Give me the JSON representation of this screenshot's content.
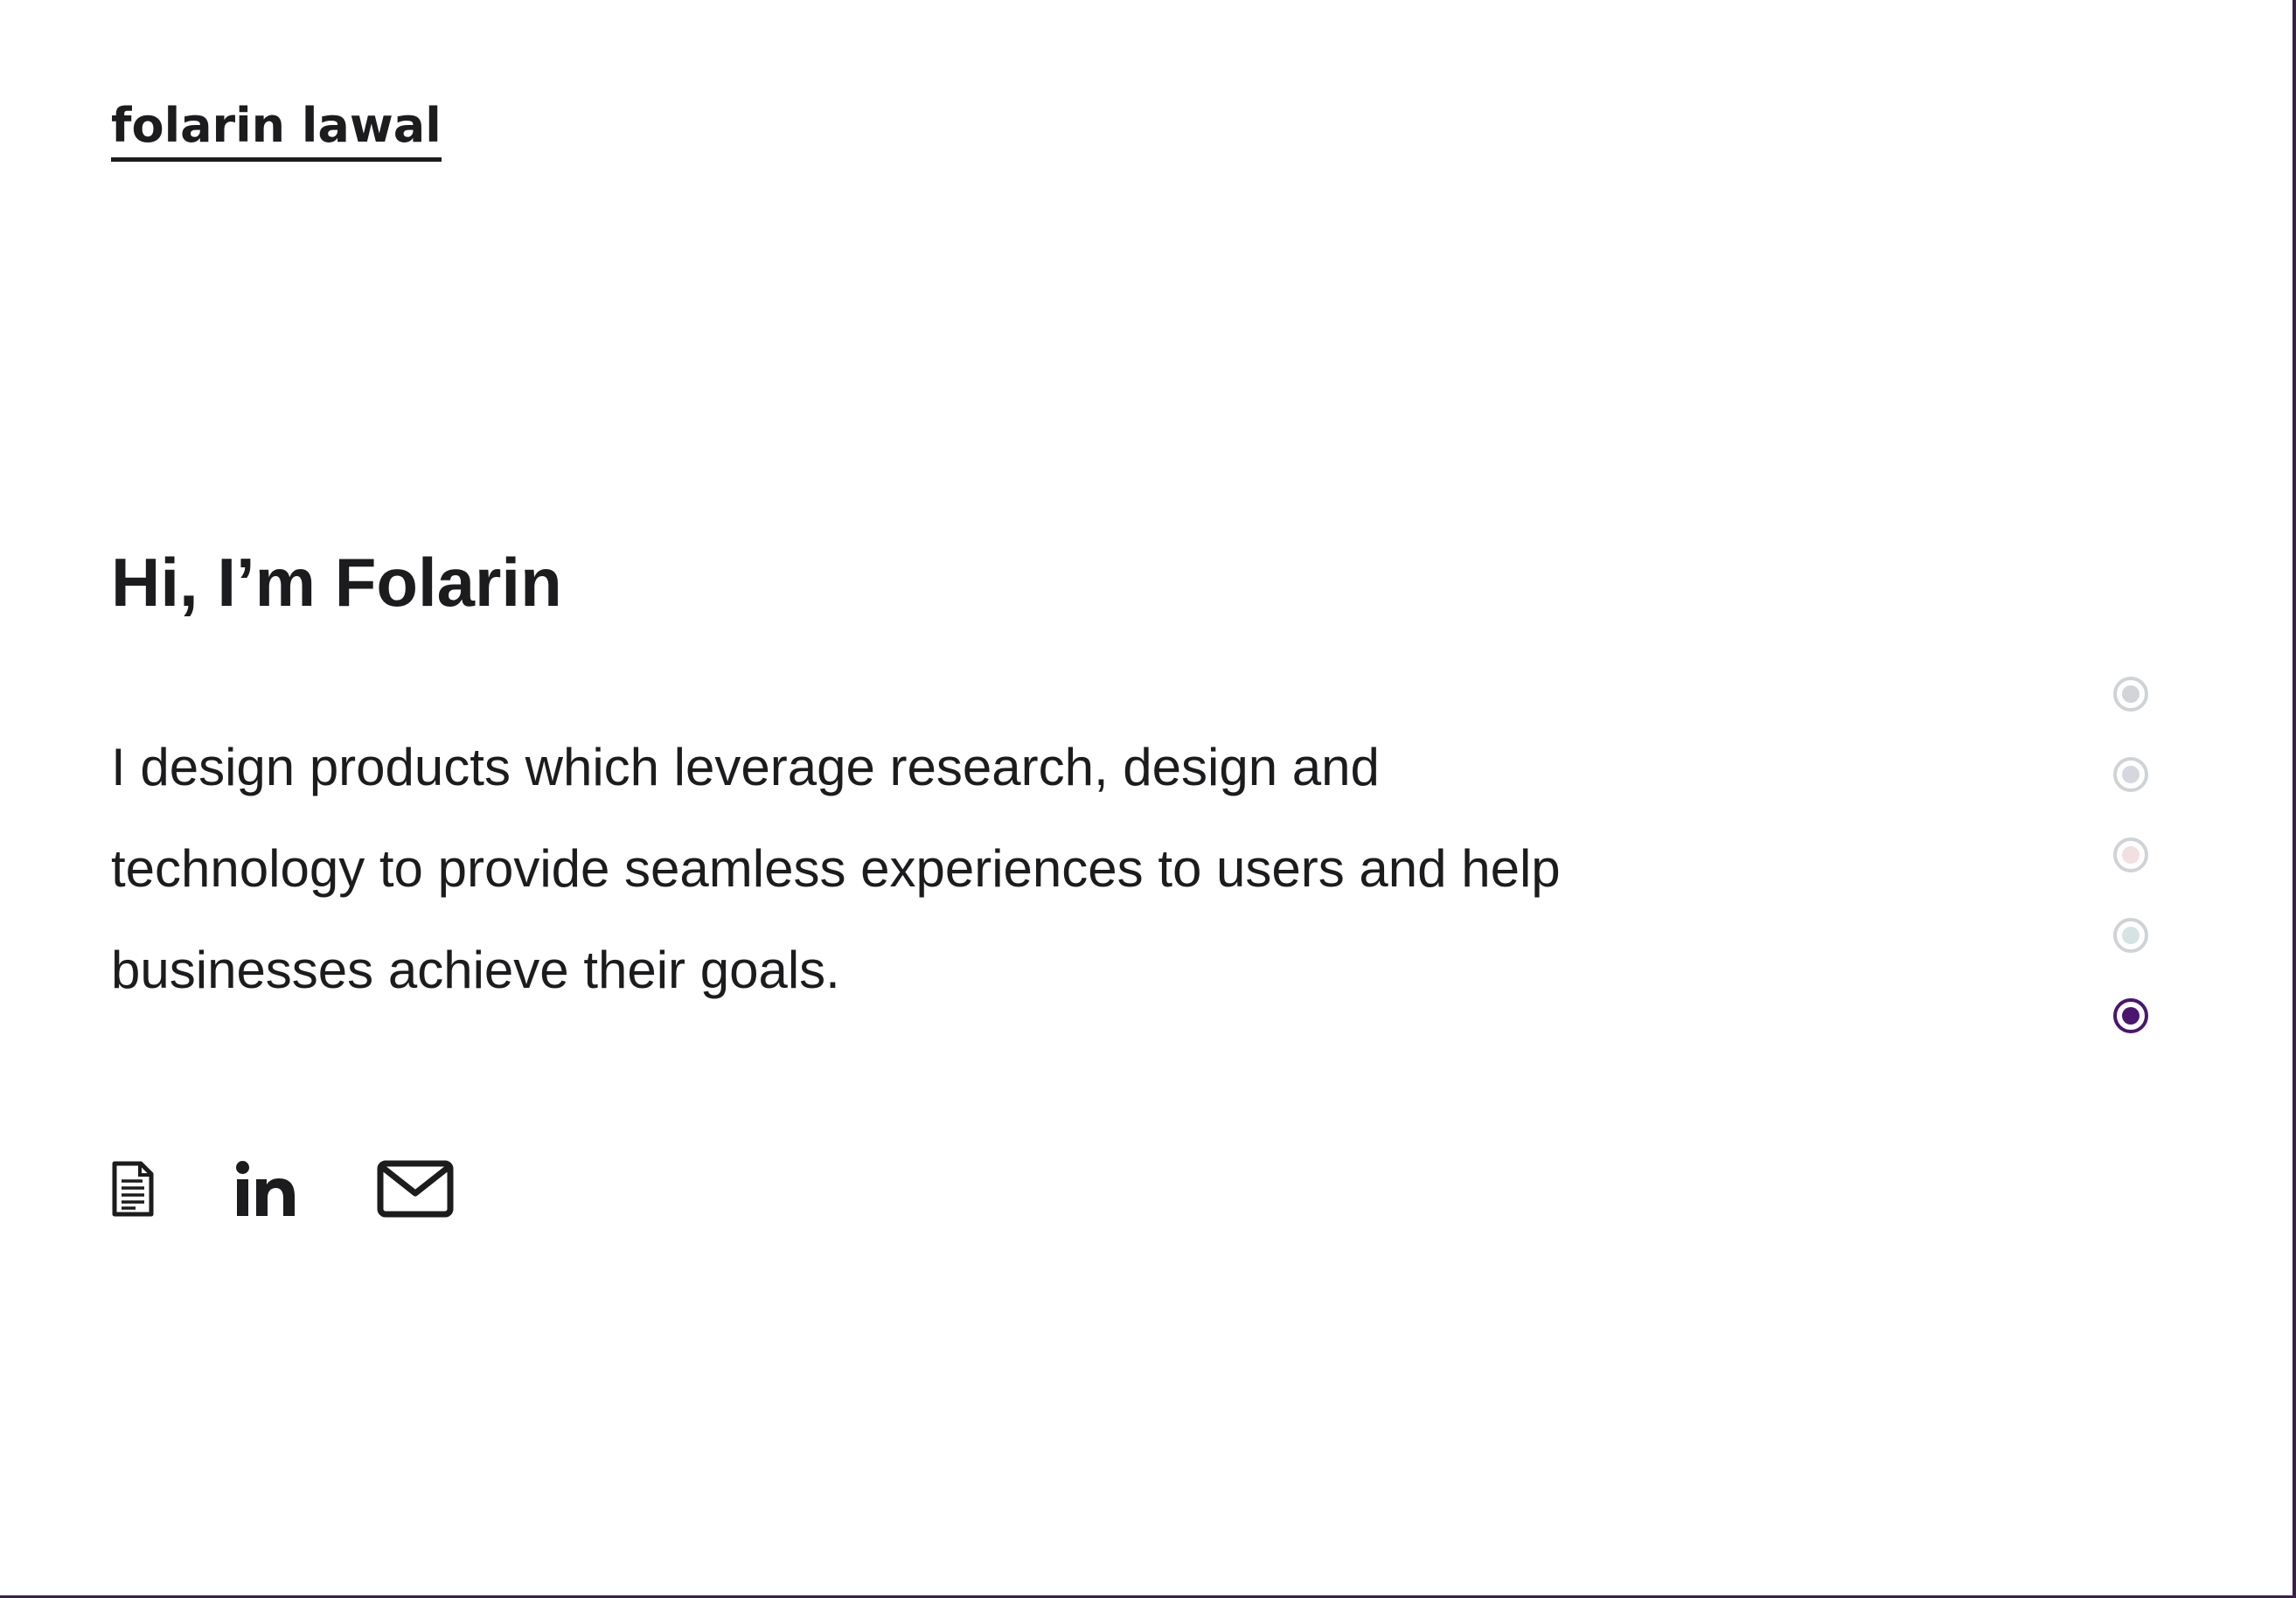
{
  "header": {
    "logo_text": "folarin lawal"
  },
  "hero": {
    "heading": "Hi, I’m Folarin",
    "intro": "I design products which leverage research, design and technology to provide seamless experiences to users and help businesses achieve their goals."
  },
  "social_links": [
    {
      "icon": "document-icon",
      "label": "resume"
    },
    {
      "icon": "linkedin-icon",
      "label": "linkedin"
    },
    {
      "icon": "mail-icon",
      "label": "email"
    }
  ],
  "section_nav": {
    "dots": [
      {
        "color": "#d2d4d8",
        "active": false
      },
      {
        "color": "#d6d6de",
        "active": false
      },
      {
        "color": "#f1dfe1",
        "active": false
      },
      {
        "color": "#d6e3e3",
        "active": false
      },
      {
        "color": "#4a1670",
        "active": true
      }
    ]
  },
  "colors": {
    "text": "#1c1c1e",
    "accent": "#4a1670",
    "background": "#ffffff"
  }
}
